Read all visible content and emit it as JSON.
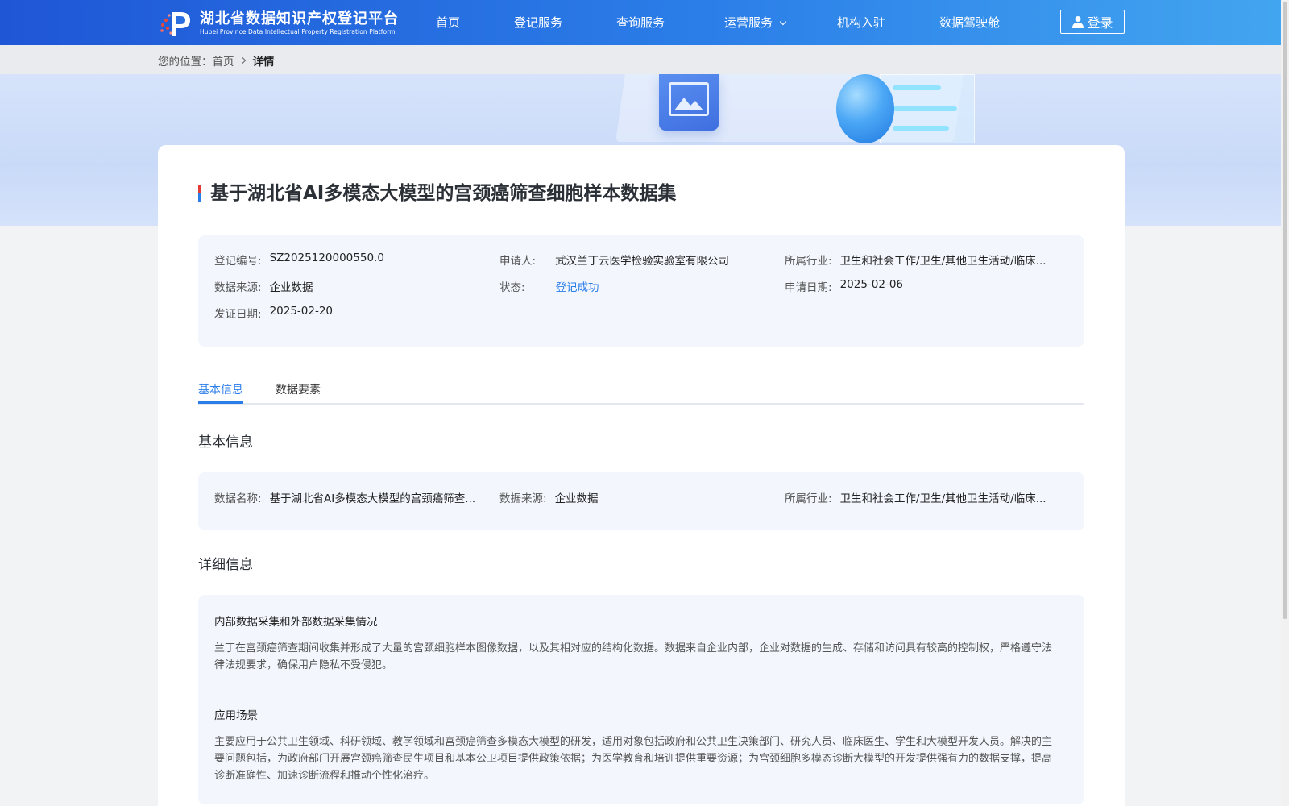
{
  "header": {
    "logo_cn": "湖北省数据知识产权登记平台",
    "logo_en": "Hubei Province Data Intellectual Property Registration Platform",
    "nav": [
      {
        "label": "首页"
      },
      {
        "label": "登记服务"
      },
      {
        "label": "查询服务"
      },
      {
        "label": "运营服务",
        "has_dropdown": true
      },
      {
        "label": "机构入驻"
      },
      {
        "label": "数据驾驶舱"
      }
    ],
    "login_label": "登录"
  },
  "breadcrumb": {
    "prefix": "您的位置：",
    "home": "首页",
    "current": "详情"
  },
  "detail": {
    "title": "基于湖北省AI多模态大模型的宫颈癌筛查细胞样本数据集",
    "summary": {
      "reg_no_label": "登记编号:",
      "reg_no": "SZ2025120000550.0",
      "applicant_label": "申请人:",
      "applicant": "武汉兰丁云医学检验实验室有限公司",
      "industry_label": "所属行业:",
      "industry": "卫生和社会工作/卫生/其他卫生活动/临床...",
      "source_label": "数据来源:",
      "source": "企业数据",
      "status_label": "状态:",
      "status": "登记成功",
      "apply_date_label": "申请日期:",
      "apply_date": "2025-02-06",
      "issue_date_label": "发证日期:",
      "issue_date": "2025-02-20"
    },
    "tabs": [
      {
        "label": "基本信息",
        "active": true
      },
      {
        "label": "数据要素",
        "active": false
      }
    ],
    "basic": {
      "section_title": "基本信息",
      "name_label": "数据名称:",
      "name": "基于湖北省AI多模态大模型的宫颈癌筛查...",
      "source_label": "数据来源:",
      "source": "企业数据",
      "industry_label": "所属行业:",
      "industry": "卫生和社会工作/卫生/其他卫生活动/临床..."
    },
    "more": {
      "section_title": "详细信息",
      "collect_title": "内部数据采集和外部数据采集情况",
      "collect_text": "兰丁在宫颈癌筛查期间收集并形成了大量的宫颈细胞样本图像数据，以及其相对应的结构化数据。数据来自企业内部，企业对数据的生成、存储和访问具有较高的控制权，严格遵守法律法规要求，确保用户隐私不受侵犯。",
      "scene_title": "应用场景",
      "scene_text": "主要应用于公共卫生领域、科研领域、教学领域和宫颈癌筛查多模态大模型的研发，适用对象包括政府和公共卫生决策部门、研究人员、临床医生、学生和大模型开发人员。解决的主要问题包括，为政府部门开展宫颈癌筛查民生项目和基本公卫项目提供政策依据；为医学教育和培训提供重要资源；为宫颈细胞多模态诊断大模型的开发提供强有力的数据支撑，提高诊断准确性、加速诊断流程和推动个性化治疗。"
    }
  },
  "colors": {
    "header_start": "#1f56d6",
    "header_end": "#43a6f0",
    "accent": "#2b7ee8",
    "panel_bg": "#f3f7fd"
  }
}
